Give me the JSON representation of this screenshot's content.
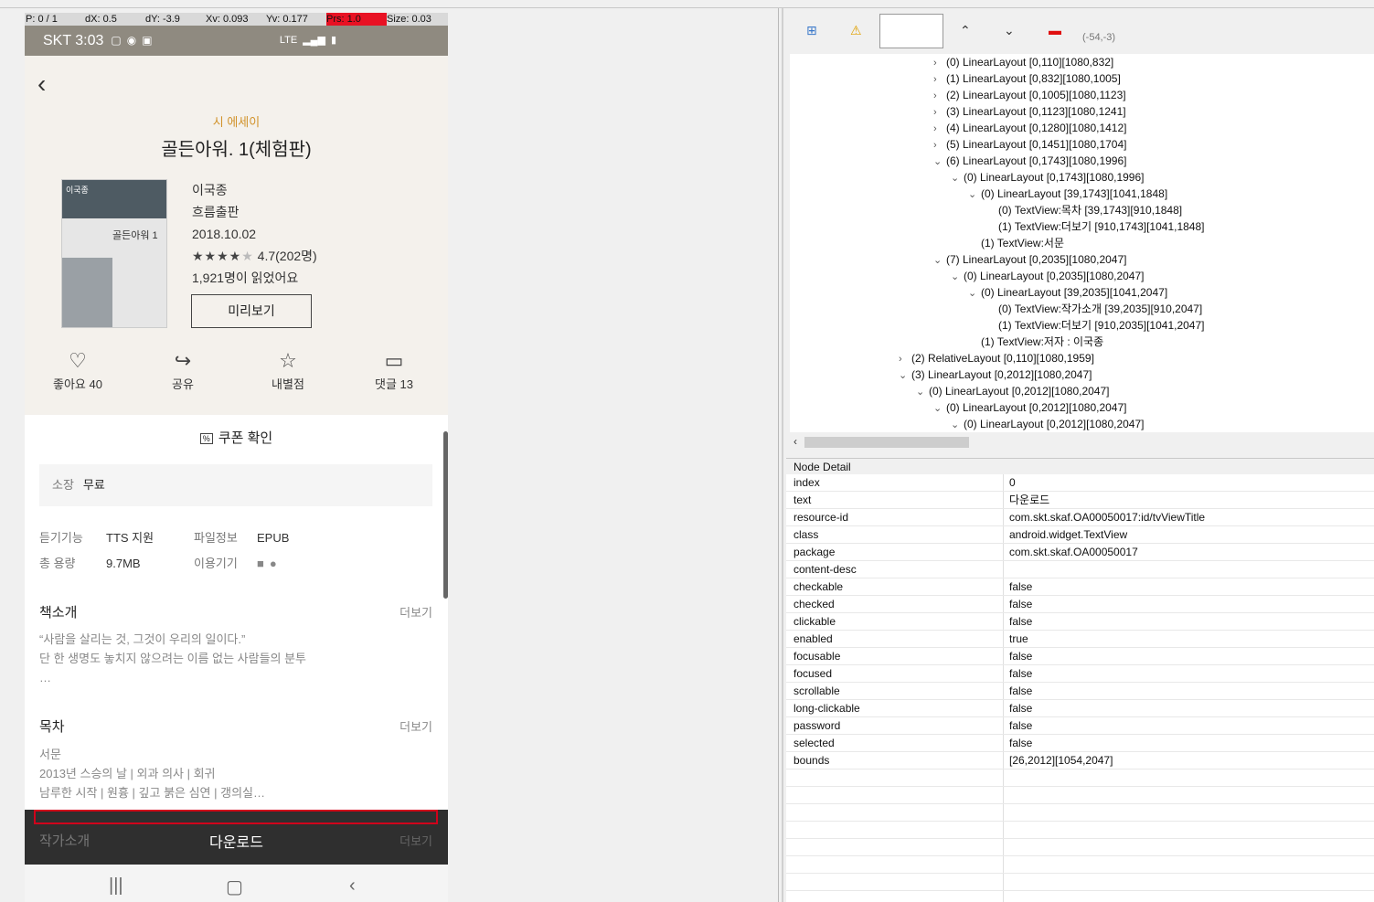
{
  "debug_bar": {
    "pointer": "P: 0 / 1",
    "dx": "dX: 0.5",
    "dy": "dY: -3.9",
    "xv": "Xv: 0.093",
    "yv": "Yv: 0.177",
    "prs": "Prs: 1.0",
    "size": "Size: 0.03"
  },
  "status_bar": {
    "carrier_time": "SKT 3:03",
    "network": "LTE"
  },
  "book": {
    "category": "시 에세이",
    "title": "골든아워. 1(체험판)",
    "author": "이국종",
    "publisher": "흐름출판",
    "date": "2018.10.02",
    "rating": "4.7(202명)",
    "read_count": "1,921명이 읽었어요",
    "preview_label": "미리보기",
    "cover_author": "이국종",
    "cover_title": "골든아워 1"
  },
  "actions": [
    {
      "label": "좋아요 40",
      "icon": "heart-icon"
    },
    {
      "label": "공유",
      "icon": "share-icon"
    },
    {
      "label": "내별점",
      "icon": "star-icon"
    },
    {
      "label": "댓글 13",
      "icon": "comment-icon"
    }
  ],
  "coupon": {
    "icon_text": "%",
    "label": "쿠폰 확인"
  },
  "ownership": {
    "label": "소장",
    "value": "무료"
  },
  "info": {
    "listen_label": "듣기기능",
    "listen_value": "TTS 지원",
    "file_label": "파일정보",
    "file_value": "EPUB",
    "size_label": "총 용량",
    "size_value": "9.7MB",
    "device_label": "이용기기"
  },
  "intro": {
    "title": "책소개",
    "more": "더보기",
    "line1": "“사람을 살리는 것, 그것이 우리의 일이다.”",
    "line2": "단 한 생명도 놓치지 않으려는 이름 없는 사람들의 분투",
    "line3": "…"
  },
  "toc": {
    "title": "목차",
    "more": "더보기",
    "line1": "서문",
    "line2": "2013년 스승의 날 | 외과 의사 | 회귀",
    "line3": "남루한 시작 | 원흉 | 깊고 붉은 심연 | 갱의실…"
  },
  "author_section": {
    "title": "작가소개",
    "more": "더보기"
  },
  "download_label": "다운로드",
  "toolbar": {
    "coords": "(-54,-3)"
  },
  "tree": [
    {
      "indent": 3,
      "toggle": "›",
      "text": "(0) LinearLayout [0,110][1080,832]"
    },
    {
      "indent": 3,
      "toggle": "›",
      "text": "(1) LinearLayout [0,832][1080,1005]"
    },
    {
      "indent": 3,
      "toggle": "›",
      "text": "(2) LinearLayout [0,1005][1080,1123]"
    },
    {
      "indent": 3,
      "toggle": "›",
      "text": "(3) LinearLayout [0,1123][1080,1241]"
    },
    {
      "indent": 3,
      "toggle": "›",
      "text": "(4) LinearLayout [0,1280][1080,1412]"
    },
    {
      "indent": 3,
      "toggle": "›",
      "text": "(5) LinearLayout [0,1451][1080,1704]"
    },
    {
      "indent": 3,
      "toggle": "⌄",
      "text": "(6) LinearLayout [0,1743][1080,1996]"
    },
    {
      "indent": 4,
      "toggle": "⌄",
      "text": "(0) LinearLayout [0,1743][1080,1996]"
    },
    {
      "indent": 5,
      "toggle": "⌄",
      "text": "(0) LinearLayout [39,1743][1041,1848]"
    },
    {
      "indent": 6,
      "toggle": "",
      "text": "(0) TextView:목차 [39,1743][910,1848]"
    },
    {
      "indent": 6,
      "toggle": "",
      "text": "(1) TextView:더보기 [910,1743][1041,1848]"
    },
    {
      "indent": 5,
      "toggle": "",
      "text": "(1) TextView:서문"
    },
    {
      "indent": 3,
      "toggle": "⌄",
      "text": "(7) LinearLayout [0,2035][1080,2047]"
    },
    {
      "indent": 4,
      "toggle": "⌄",
      "text": "(0) LinearLayout [0,2035][1080,2047]"
    },
    {
      "indent": 5,
      "toggle": "⌄",
      "text": "(0) LinearLayout [39,2035][1041,2047]"
    },
    {
      "indent": 6,
      "toggle": "",
      "text": "(0) TextView:작가소개 [39,2035][910,2047]"
    },
    {
      "indent": 6,
      "toggle": "",
      "text": "(1) TextView:더보기 [910,2035][1041,2047]"
    },
    {
      "indent": 5,
      "toggle": "",
      "text": "(1) TextView:저자 : 이국종"
    },
    {
      "indent": 1,
      "toggle": "›",
      "text": "(2) RelativeLayout [0,110][1080,1959]"
    },
    {
      "indent": 1,
      "toggle": "⌄",
      "text": "(3) LinearLayout [0,2012][1080,2047]"
    },
    {
      "indent": 2,
      "toggle": "⌄",
      "text": "(0) LinearLayout [0,2012][1080,2047]"
    },
    {
      "indent": 3,
      "toggle": "⌄",
      "text": "(0) LinearLayout [0,2012][1080,2047]"
    },
    {
      "indent": 4,
      "toggle": "⌄",
      "text": "(0) LinearLayout [0,2012][1080,2047]"
    }
  ],
  "node_detail": {
    "header": "Node Detail",
    "rows": [
      {
        "k": "index",
        "v": "0"
      },
      {
        "k": "text",
        "v": "다운로드"
      },
      {
        "k": "resource-id",
        "v": "com.skt.skaf.OA00050017:id/tvViewTitle"
      },
      {
        "k": "class",
        "v": "android.widget.TextView"
      },
      {
        "k": "package",
        "v": "com.skt.skaf.OA00050017"
      },
      {
        "k": "content-desc",
        "v": ""
      },
      {
        "k": "checkable",
        "v": "false"
      },
      {
        "k": "checked",
        "v": "false"
      },
      {
        "k": "clickable",
        "v": "false"
      },
      {
        "k": "enabled",
        "v": "true"
      },
      {
        "k": "focusable",
        "v": "false"
      },
      {
        "k": "focused",
        "v": "false"
      },
      {
        "k": "scrollable",
        "v": "false"
      },
      {
        "k": "long-clickable",
        "v": "false"
      },
      {
        "k": "password",
        "v": "false"
      },
      {
        "k": "selected",
        "v": "false"
      },
      {
        "k": "bounds",
        "v": "[26,2012][1054,2047]"
      }
    ]
  },
  "colors": {
    "accent": "#d1922a",
    "highlight": "#d0021b",
    "statusbar": "#8f8a80"
  }
}
